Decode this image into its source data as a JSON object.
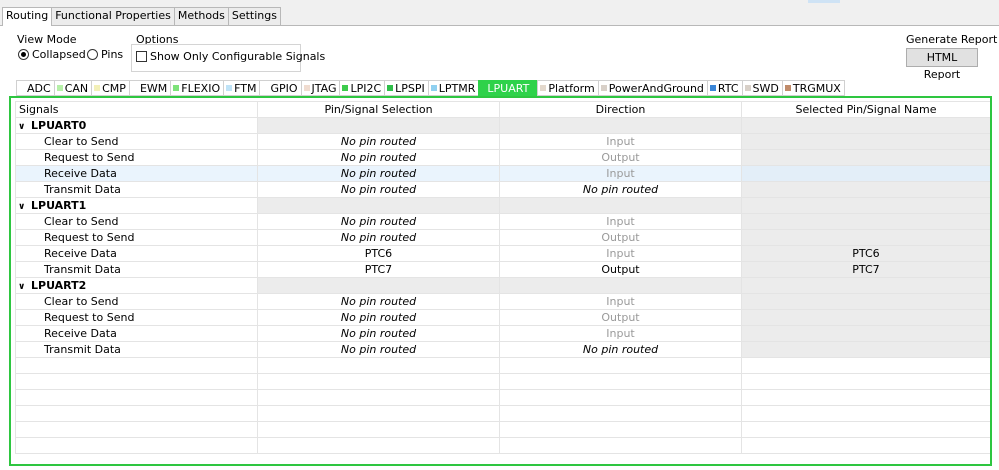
{
  "window": {
    "tabs": [
      {
        "label": "Routing",
        "active": true
      },
      {
        "label": "Functional Properties",
        "active": false
      },
      {
        "label": "Methods",
        "active": false
      },
      {
        "label": "Settings",
        "active": false
      }
    ]
  },
  "view_mode": {
    "title": "View Mode",
    "options": [
      {
        "label": "Collapsed",
        "selected": true
      },
      {
        "label": "Pins",
        "selected": false
      }
    ]
  },
  "options": {
    "title": "Options",
    "show_only_configurable": {
      "label": "Show Only Configurable Signals",
      "checked": false
    }
  },
  "generate_report": {
    "title": "Generate Report",
    "button_label": "HTML Report"
  },
  "peripheral_tabs": [
    {
      "label": "ADC",
      "color": "#ffffff"
    },
    {
      "label": "CAN",
      "color": "#b6f0a8"
    },
    {
      "label": "CMP",
      "color": "#f3f0b8"
    },
    {
      "label": "EWM",
      "color": "#ffffff"
    },
    {
      "label": "FLEXIO",
      "color": "#7ee27a"
    },
    {
      "label": "FTM",
      "color": "#bfe3f7"
    },
    {
      "label": "GPIO",
      "color": "#ffffff"
    },
    {
      "label": "JTAG",
      "color": "#f0dcd0"
    },
    {
      "label": "LPI2C",
      "color": "#3dcb4c"
    },
    {
      "label": "LPSPI",
      "color": "#2fbf4a"
    },
    {
      "label": "LPTMR",
      "color": "#8fd0f0"
    },
    {
      "label": "LPUART",
      "color": "#2ed24a",
      "active": true
    },
    {
      "label": "Platform",
      "color": "#e3d8cc"
    },
    {
      "label": "PowerAndGround",
      "color": "#d8d0c8"
    },
    {
      "label": "RTC",
      "color": "#3a86d8"
    },
    {
      "label": "SWD",
      "color": "#d8d0c8"
    },
    {
      "label": "TRGMUX",
      "color": "#c08b6a"
    }
  ],
  "table": {
    "headers": [
      "Signals",
      "Pin/Signal Selection",
      "Direction",
      "Selected Pin/Signal Name"
    ],
    "groups": [
      {
        "name": "LPUART0",
        "rows": [
          {
            "signal": "Clear to Send",
            "pin": "No pin routed",
            "direction": "Input",
            "name": ""
          },
          {
            "signal": "Request to Send",
            "pin": "No pin routed",
            "direction": "Output",
            "name": ""
          },
          {
            "signal": "Receive Data",
            "pin": "No pin routed",
            "direction": "Input",
            "name": "",
            "selected": true
          },
          {
            "signal": "Transmit Data",
            "pin": "No pin routed",
            "direction": "No pin routed",
            "name": ""
          }
        ]
      },
      {
        "name": "LPUART1",
        "rows": [
          {
            "signal": "Clear to Send",
            "pin": "No pin routed",
            "direction": "Input",
            "name": ""
          },
          {
            "signal": "Request to Send",
            "pin": "No pin routed",
            "direction": "Output",
            "name": ""
          },
          {
            "signal": "Receive Data",
            "pin": "PTC6",
            "direction": "Input",
            "name": "PTC6"
          },
          {
            "signal": "Transmit Data",
            "pin": "PTC7",
            "direction": "Output",
            "name": "PTC7"
          }
        ]
      },
      {
        "name": "LPUART2",
        "rows": [
          {
            "signal": "Clear to Send",
            "pin": "No pin routed",
            "direction": "Input",
            "name": ""
          },
          {
            "signal": "Request to Send",
            "pin": "No pin routed",
            "direction": "Output",
            "name": ""
          },
          {
            "signal": "Receive Data",
            "pin": "No pin routed",
            "direction": "Input",
            "name": ""
          },
          {
            "signal": "Transmit Data",
            "pin": "No pin routed",
            "direction": "No pin routed",
            "name": ""
          }
        ]
      }
    ]
  }
}
